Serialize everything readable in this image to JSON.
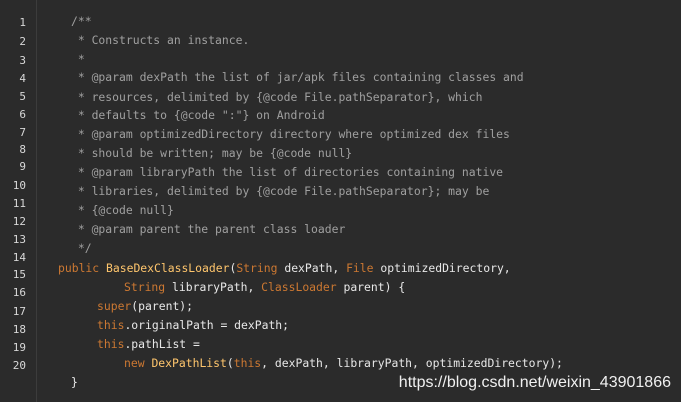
{
  "line_numbers": [
    "1",
    "2",
    "3",
    "4",
    "5",
    "6",
    "7",
    "8",
    "9",
    "10",
    "11",
    "12",
    "13",
    "14",
    "15",
    "16",
    "17",
    "18",
    "19",
    "20"
  ],
  "code": {
    "l1": "/**",
    "l2": " * Constructs an instance.",
    "l3": " *",
    "l4": " * @param dexPath the list of jar/apk files containing classes and",
    "l5": " * resources, delimited by {@code File.pathSeparator}, which",
    "l6": " * defaults to {@code \":\"} on Android",
    "l7": " * @param optimizedDirectory directory where optimized dex files",
    "l8": " * should be written; may be {@code null}",
    "l9": " * @param libraryPath the list of directories containing native",
    "l10": " * libraries, delimited by {@code File.pathSeparator}; may be",
    "l11": " * {@code null}",
    "l12": " * @param parent the parent class loader",
    "l13": " */",
    "l14": {
      "kw_public": "public",
      "name": "BaseDexClassLoader",
      "p1": "(",
      "t1": "String",
      "a1": " dexPath, ",
      "t2": "File",
      "a2": " optimizedDirectory,"
    },
    "l15": {
      "t1": "String",
      "a1": " libraryPath, ",
      "t2": "ClassLoader",
      "a2": " parent) {"
    },
    "l16": {
      "kw": "super",
      "rest": "(parent);"
    },
    "l17": {
      "kw": "this",
      "rest": ".originalPath = dexPath;"
    },
    "l18": {
      "kw": "this",
      "rest": ".pathList ="
    },
    "l19": {
      "kw_new": "new",
      "sp": " ",
      "name": "DexPathList",
      "p": "(",
      "kw_this": "this",
      "rest": ", dexPath, libraryPath, optimizedDirectory);"
    },
    "l20": "}"
  },
  "watermark": "https://blog.csdn.net/weixin_43901866",
  "colors": {
    "background": "#2b2b2b",
    "comment": "#a0a0a0",
    "keyword": "#cc7832",
    "type_name": "#ffc66d",
    "plain": "#e8e8e8"
  }
}
